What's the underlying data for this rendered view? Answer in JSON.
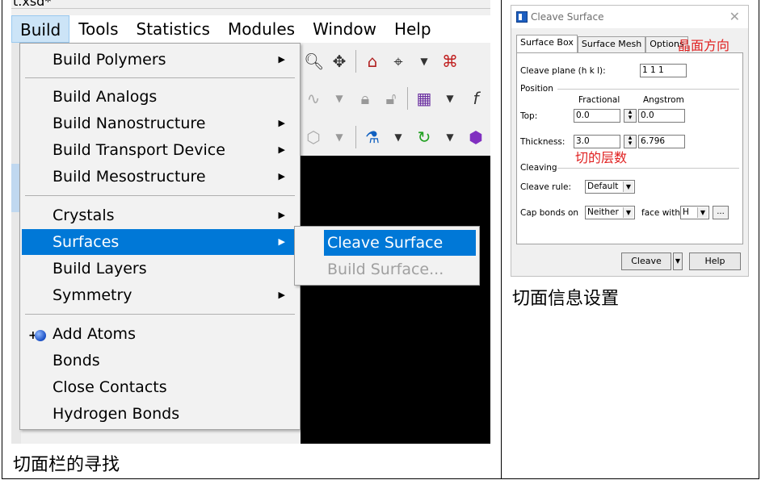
{
  "title_fragment": "t.xsd*",
  "menubar": [
    "Build",
    "Tools",
    "Statistics",
    "Modules",
    "Window",
    "Help"
  ],
  "build_menu": {
    "group1": [
      {
        "label": "Build Polymers",
        "arrow": true
      }
    ],
    "group2": [
      {
        "label": "Build Analogs",
        "arrow": false
      },
      {
        "label": "Build Nanostructure",
        "arrow": true
      },
      {
        "label": "Build Transport Device",
        "arrow": true
      },
      {
        "label": "Build Mesostructure",
        "arrow": true
      }
    ],
    "group3": [
      {
        "label": "Crystals",
        "arrow": true
      },
      {
        "label": "Surfaces",
        "arrow": true
      },
      {
        "label": "Build Layers",
        "arrow": false
      },
      {
        "label": "Symmetry",
        "arrow": true
      }
    ],
    "group4": [
      {
        "label": "Add Atoms",
        "arrow": false
      },
      {
        "label": "Bonds",
        "arrow": false
      },
      {
        "label": "Close Contacts",
        "arrow": false
      },
      {
        "label": "Hydrogen Bonds",
        "arrow": false
      }
    ]
  },
  "surfaces_submenu": {
    "cleave": "Cleave Surface",
    "build": "Build Surface..."
  },
  "caption_left": "切面栏的寻找",
  "dialog": {
    "title": "Cleave Surface",
    "tabs": [
      "Surface Box",
      "Surface Mesh",
      "Options"
    ],
    "tab_annotation": "晶面方向",
    "cleave_plane_label": "Cleave plane (h k l):",
    "cleave_plane_value": "1  1  1",
    "position_label": "Position",
    "fractional_label": "Fractional",
    "angstrom_label": "Angstrom",
    "top_label": "Top:",
    "top_fractional": "0.0",
    "top_angstrom": "0.0",
    "thickness_label": "Thickness:",
    "thickness_fractional": "3.0",
    "thickness_angstrom": "6.796",
    "thickness_annotation": "切的层数",
    "cleaving_label": "Cleaving",
    "cleave_rule_label": "Cleave rule:",
    "cleave_rule_value": "Default",
    "cap_bonds_label": "Cap bonds on",
    "cap_bonds_value": "Neither",
    "face_with_label": "face with",
    "face_with_value": "H",
    "ellipsis_label": "...",
    "cleave_button": "Cleave",
    "help_button": "Help"
  },
  "caption_right": "切面信息设置"
}
